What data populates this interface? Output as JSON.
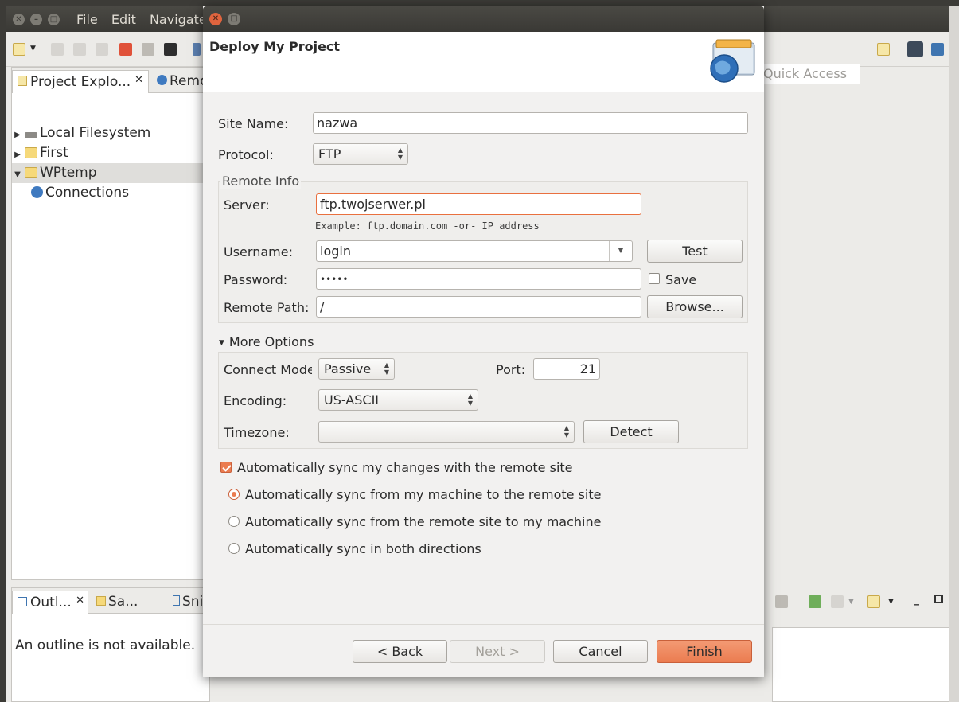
{
  "ide": {
    "menu": [
      "File",
      "Edit",
      "Navigate"
    ],
    "quick_access_placeholder": "Quick Access",
    "left_tabs": [
      "Project Explo...",
      "Remo"
    ],
    "tree": [
      {
        "label": "Local Filesystem",
        "expanded": false
      },
      {
        "label": "First",
        "expanded": false
      },
      {
        "label": "WPtemp",
        "expanded": true,
        "selected": true
      },
      {
        "label": "Connections",
        "child": true
      }
    ],
    "bottom_tabs": [
      "Outl...",
      "Sa...",
      "Sni"
    ],
    "outline_message": "An outline is not available."
  },
  "dialog": {
    "title": "Deploy My Project",
    "site_name_label": "Site Name:",
    "site_name_value": "nazwa",
    "protocol_label": "Protocol:",
    "protocol_value": "FTP",
    "remote_info": {
      "title": "Remote Info",
      "server_label": "Server:",
      "server_value": "ftp.twojserwer.pl",
      "server_hint": "Example: ftp.domain.com -or- IP address",
      "username_label": "Username:",
      "username_value": "login",
      "test_button": "Test",
      "password_label": "Password:",
      "password_value": "•••••",
      "save_label": "Save",
      "save_checked": false,
      "remote_path_label": "Remote Path:",
      "remote_path_value": "/",
      "browse_button": "Browse..."
    },
    "more_options": {
      "title": "More Options",
      "connect_mode_label": "Connect Mode",
      "connect_mode_value": "Passive",
      "port_label": "Port:",
      "port_value": "21",
      "encoding_label": "Encoding:",
      "encoding_value": "US-ASCII",
      "timezone_label": "Timezone:",
      "timezone_value": "",
      "detect_button": "Detect"
    },
    "auto_sync": {
      "label": "Automatically sync my changes with the remote site",
      "checked": true,
      "options": [
        {
          "label": "Automatically sync from my machine to the remote site",
          "selected": true
        },
        {
          "label": "Automatically sync from the remote site to my machine",
          "selected": false
        },
        {
          "label": "Automatically sync in both directions",
          "selected": false
        }
      ]
    },
    "buttons": {
      "back": "< Back",
      "next": "Next >",
      "cancel": "Cancel",
      "finish": "Finish"
    },
    "colors": {
      "accent": "#eb7c50",
      "focus_border": "#e9703f"
    }
  }
}
